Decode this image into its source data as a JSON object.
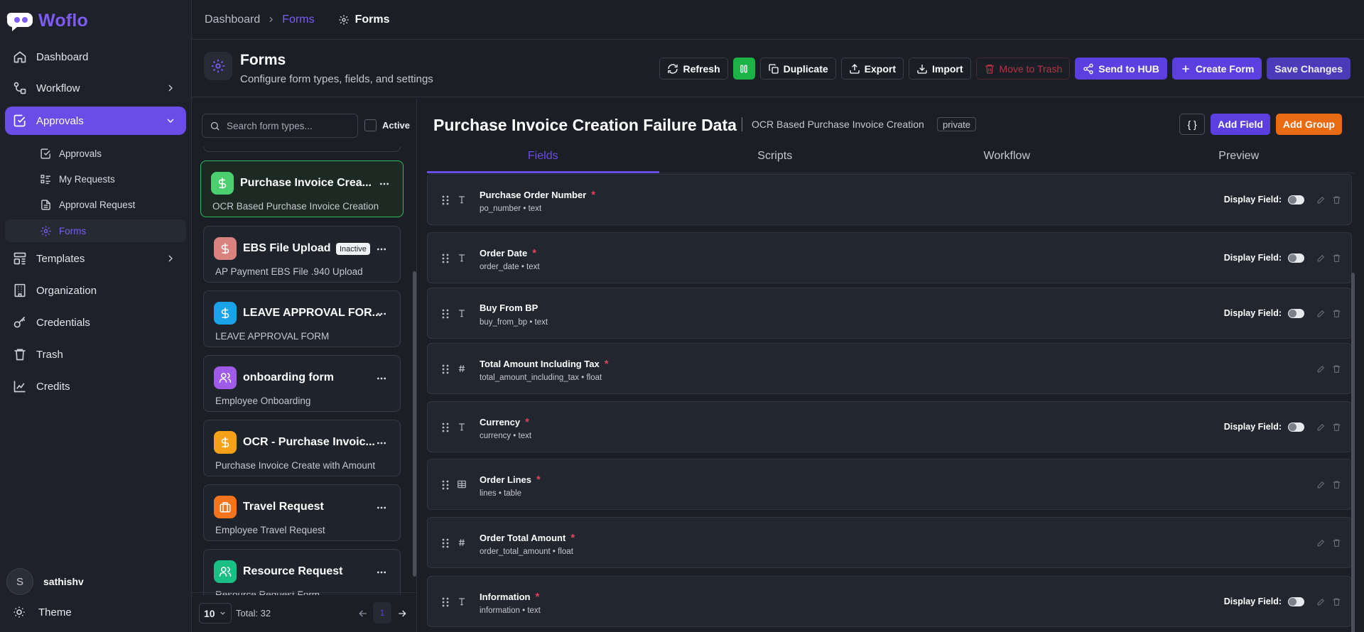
{
  "app": {
    "name": "Woflo"
  },
  "sidebar": {
    "items": [
      {
        "label": "Dashboard",
        "icon": "home-icon"
      },
      {
        "label": "Workflow",
        "icon": "workflow-icon"
      },
      {
        "label": "Approvals",
        "icon": "check-square-icon"
      },
      {
        "label": "Templates",
        "icon": "layout-icon"
      },
      {
        "label": "Organization",
        "icon": "building-icon"
      },
      {
        "label": "Credentials",
        "icon": "key-icon"
      },
      {
        "label": "Trash",
        "icon": "trash-icon"
      },
      {
        "label": "Credits",
        "icon": "chart-icon"
      }
    ],
    "subitems": [
      {
        "label": "Approvals",
        "icon": "check-square-icon"
      },
      {
        "label": "My Requests",
        "icon": "list-icon"
      },
      {
        "label": "Approval Request",
        "icon": "file-icon"
      },
      {
        "label": "Forms",
        "icon": "gear-icon"
      }
    ],
    "user": {
      "initial": "S",
      "name": "sathishv"
    },
    "theme_label": "Theme"
  },
  "breadcrumb": {
    "root": "Dashboard",
    "link": "Forms",
    "current": "Forms"
  },
  "header": {
    "title": "Forms",
    "subtitle": "Configure form types, fields, and settings",
    "buttons": {
      "refresh": "Refresh",
      "duplicate": "Duplicate",
      "export": "Export",
      "import": "Import",
      "trash": "Move to Trash",
      "hub": "Send to HUB",
      "create": "Create Form",
      "save": "Save Changes"
    }
  },
  "list": {
    "search_placeholder": "Search form types...",
    "active_label": "Active",
    "cards": [
      {
        "name": "Purchase Invoice Crea...",
        "desc": "OCR Based Purchase Invoice Creation",
        "icon": "dollar-icon",
        "color": "#4ccf6f"
      },
      {
        "name": "EBS File Upload",
        "desc": "AP Payment EBS File .940 Upload",
        "icon": "dollar-icon",
        "color": "#d9827f",
        "badge": "Inactive"
      },
      {
        "name": "LEAVE APPROVAL FOR...",
        "desc": "LEAVE APPROVAL FORM",
        "icon": "dollar-icon",
        "color": "#1aa3e8"
      },
      {
        "name": "onboarding form",
        "desc": "Employee Onboarding",
        "icon": "users-icon",
        "color": "#a05ae8"
      },
      {
        "name": "OCR - Purchase Invoic...",
        "desc": "Purchase Invoice Create with Amount",
        "icon": "dollar-icon",
        "color": "#f5a218"
      },
      {
        "name": "Travel Request",
        "desc": "Employee Travel Request",
        "icon": "briefcase-icon",
        "color": "#f2741c"
      },
      {
        "name": "Resource Request",
        "desc": "Resource Request Form",
        "icon": "users-icon",
        "color": "#1bbf86"
      }
    ],
    "page_size": "10",
    "total": "Total: 32",
    "current_page": "1"
  },
  "detail": {
    "title": "Purchase Invoice Creation Failure Data",
    "subtitle": "OCR Based Purchase Invoice Creation",
    "visibility": "private",
    "json_button": "{ }",
    "add_field": "Add Field",
    "add_group": "Add Group",
    "tabs": [
      "Fields",
      "Scripts",
      "Workflow",
      "Preview"
    ],
    "display_label": "Display Field:",
    "fields": [
      {
        "label": "Purchase Order Number",
        "key": "po_number",
        "type": "text",
        "type_icon": "text-type-icon",
        "required": true,
        "display": true
      },
      {
        "label": "Order Date",
        "key": "order_date",
        "type": "text",
        "type_icon": "text-type-icon",
        "required": true,
        "display": true
      },
      {
        "label": "Buy From BP",
        "key": "buy_from_bp",
        "type": "text",
        "type_icon": "text-type-icon",
        "required": false,
        "display": true
      },
      {
        "label": "Total Amount Including Tax",
        "key": "total_amount_including_tax",
        "type": "float",
        "type_icon": "hash-icon",
        "required": true,
        "display": false
      },
      {
        "label": "Currency",
        "key": "currency",
        "type": "text",
        "type_icon": "text-type-icon",
        "required": true,
        "display": true
      },
      {
        "label": "Order Lines",
        "key": "lines",
        "type": "table",
        "type_icon": "table-icon",
        "required": true,
        "display": false
      },
      {
        "label": "Order Total Amount",
        "key": "order_total_amount",
        "type": "float",
        "type_icon": "hash-icon",
        "required": true,
        "display": false
      },
      {
        "label": "Information",
        "key": "information",
        "type": "text",
        "type_icon": "text-type-icon",
        "required": true,
        "display": true
      }
    ]
  }
}
